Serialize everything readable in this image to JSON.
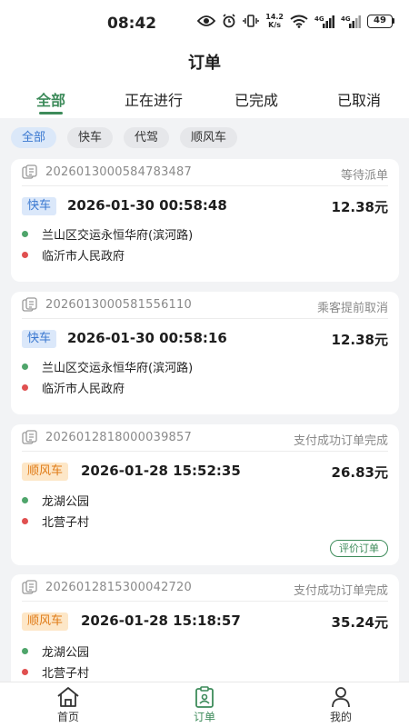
{
  "status_bar": {
    "time": "08:42",
    "net_speed_value": "14.2",
    "net_speed_unit": "K/s",
    "signal1_label": "4G",
    "signal2_label": "4G",
    "battery": "49"
  },
  "header": {
    "title": "订单"
  },
  "tabs": [
    {
      "label": "全部",
      "active": true
    },
    {
      "label": "正在进行",
      "active": false
    },
    {
      "label": "已完成",
      "active": false
    },
    {
      "label": "已取消",
      "active": false
    }
  ],
  "filters": [
    {
      "label": "全部",
      "active": true
    },
    {
      "label": "快车",
      "active": false
    },
    {
      "label": "代驾",
      "active": false
    },
    {
      "label": "顺风车",
      "active": false
    }
  ],
  "orders": [
    {
      "order_no": "2026013000584783487",
      "status": "等待派单",
      "type": "快车",
      "type_color": "blue",
      "time": "2026-01-30 00:58:48",
      "price": "12.38元",
      "from": "兰山区交运永恒华府(滨河路)",
      "to": "临沂市人民政府"
    },
    {
      "order_no": "2026013000581556110",
      "status": "乘客提前取消",
      "type": "快车",
      "type_color": "blue",
      "time": "2026-01-30 00:58:16",
      "price": "12.38元",
      "from": "兰山区交运永恒华府(滨河路)",
      "to": "临沂市人民政府"
    },
    {
      "order_no": "2026012818000039857",
      "status": "支付成功订单完成",
      "type": "顺风车",
      "type_color": "orange",
      "time": "2026-01-28 15:52:35",
      "price": "26.83元",
      "from": "龙湖公园",
      "to": "北营子村",
      "action": "评价订单"
    },
    {
      "order_no": "2026012815300042720",
      "status": "支付成功订单完成",
      "type": "顺风车",
      "type_color": "orange",
      "time": "2026-01-28 15:18:57",
      "price": "35.24元",
      "from": "龙湖公园",
      "to": "北营子村"
    }
  ],
  "bottom_nav": [
    {
      "label": "首页",
      "icon": "home-icon",
      "active": false
    },
    {
      "label": "订单",
      "icon": "order-icon",
      "active": true
    },
    {
      "label": "我的",
      "icon": "user-icon",
      "active": false
    }
  ],
  "colors": {
    "accent": "#3d8b5a",
    "blue_tag": "#3a78d0",
    "orange_tag": "#e07b16",
    "start_dot": "#4fa56b",
    "end_dot": "#e05050"
  }
}
